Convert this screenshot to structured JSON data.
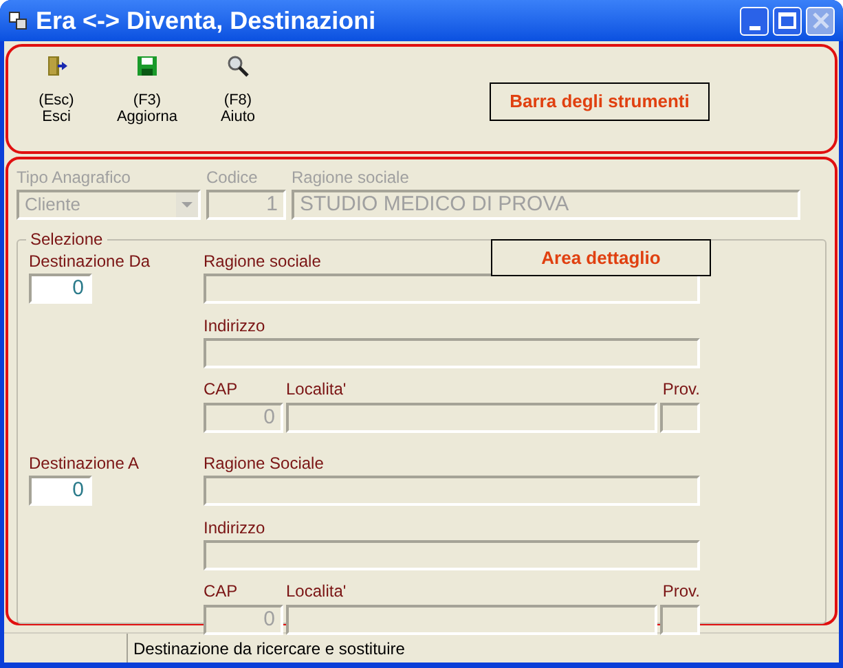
{
  "window": {
    "title": "Era <-> Diventa, Destinazioni",
    "controls": [
      {
        "kind": "minimize",
        "disabled": false
      },
      {
        "kind": "maximize",
        "disabled": false
      },
      {
        "kind": "close",
        "disabled": true
      }
    ]
  },
  "toolbar": {
    "buttons": [
      {
        "kind": "exit",
        "shortcut": "(Esc)",
        "label": "Esci"
      },
      {
        "kind": "save",
        "shortcut": "(F3)",
        "label": "Aggiorna"
      },
      {
        "kind": "search",
        "shortcut": "(F8)",
        "label": "Aiuto"
      }
    ],
    "annotation": "Barra degli strumenti"
  },
  "header": {
    "tipo": {
      "label": "Tipo Anagrafico",
      "value": "Cliente",
      "disabled": true
    },
    "codice": {
      "label": "Codice",
      "value": "1",
      "disabled": true
    },
    "ragione": {
      "label": "Ragione sociale",
      "value": "STUDIO MEDICO DI PROVA",
      "disabled": true
    }
  },
  "selezione": {
    "title": "Selezione",
    "annotation": "Area dettaglio",
    "groups": [
      {
        "label": "Destinazione Da",
        "value": "0",
        "ragione_label": "Ragione sociale",
        "indirizzo_label": "Indirizzo",
        "cap_label": "CAP",
        "cap_value": "0",
        "localita_label": "Localita'",
        "prov_label": "Prov."
      },
      {
        "label": "Destinazione A",
        "value": "0",
        "ragione_label": "Ragione Sociale",
        "indirizzo_label": "Indirizzo",
        "cap_label": "CAP",
        "cap_value": "0",
        "localita_label": "Localita'",
        "prov_label": "Prov."
      }
    ]
  },
  "status_bar": {
    "text": "Destinazione da ricercare e sostituire"
  }
}
